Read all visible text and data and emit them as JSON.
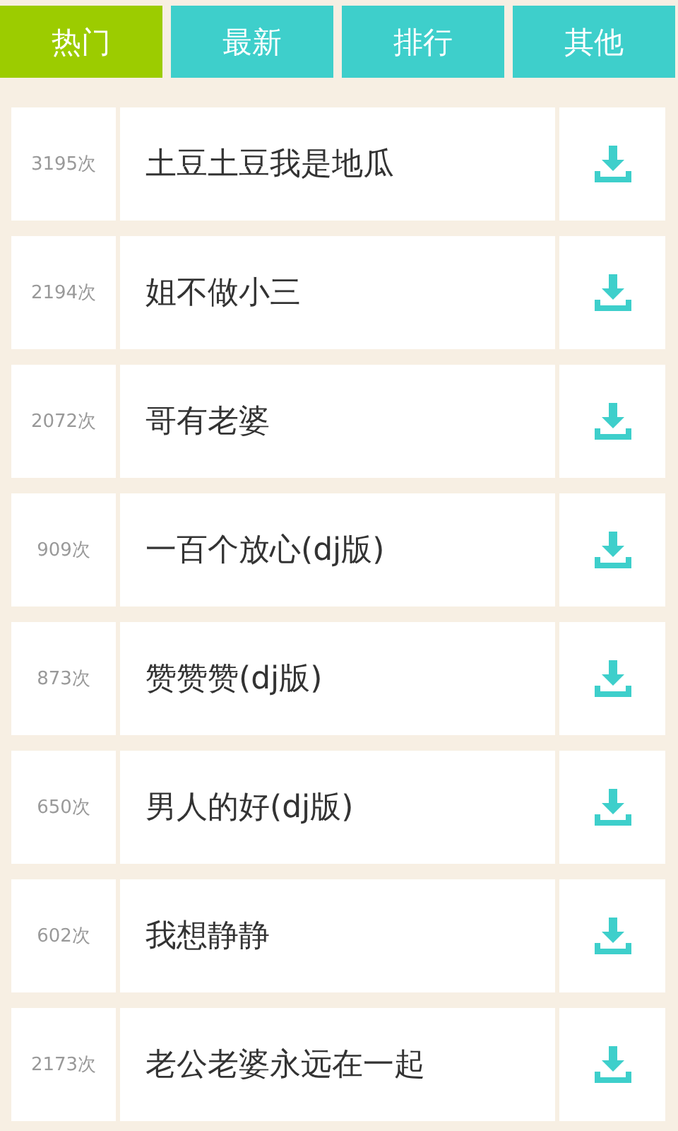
{
  "tabs": [
    {
      "label": "热门",
      "selected": true
    },
    {
      "label": "最新",
      "selected": false
    },
    {
      "label": "排行",
      "selected": false
    },
    {
      "label": "其他",
      "selected": false
    }
  ],
  "songs": [
    {
      "count": "3195次",
      "title": "土豆土豆我是地瓜"
    },
    {
      "count": "2194次",
      "title": "姐不做小三"
    },
    {
      "count": "2072次",
      "title": "哥有老婆"
    },
    {
      "count": "909次",
      "title": "一百个放心(dj版)"
    },
    {
      "count": "873次",
      "title": "赞赞赞(dj版)"
    },
    {
      "count": "650次",
      "title": "男人的好(dj版)"
    },
    {
      "count": "602次",
      "title": "我想静静"
    },
    {
      "count": "2173次",
      "title": "老公老婆永远在一起"
    }
  ]
}
